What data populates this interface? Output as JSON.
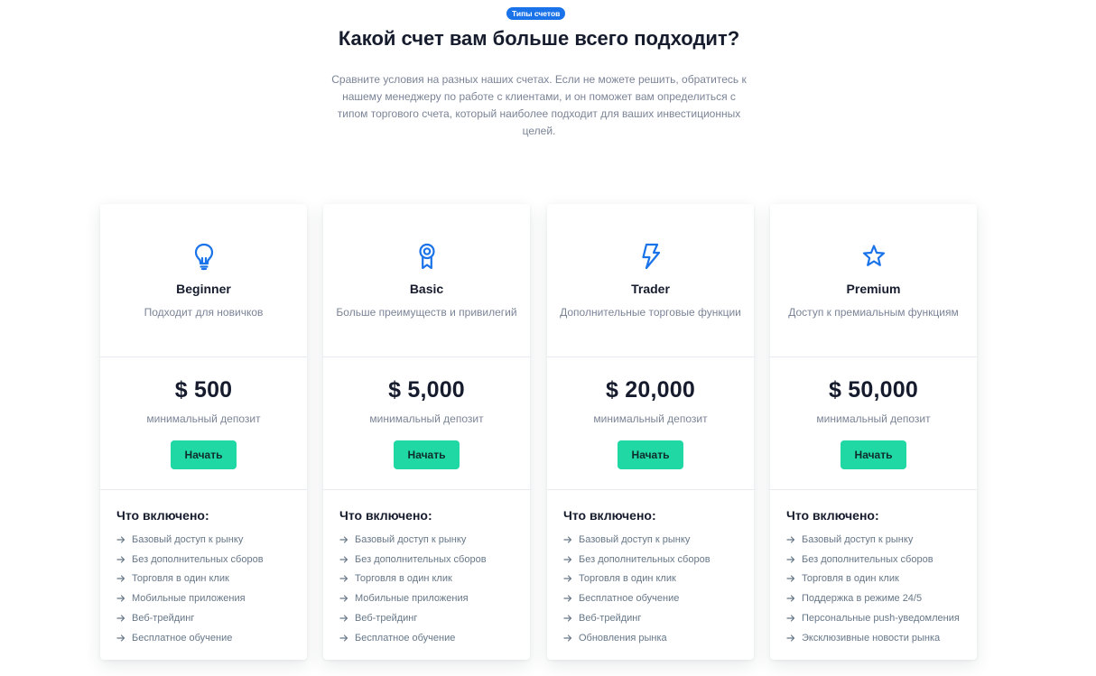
{
  "header": {
    "badge": "Типы счетов",
    "title": "Какой счет вам больше всего подходит?",
    "lead": "Сравните условия на разных наших счетах. Если не можете решить, обратитесь к нашему менеджеру по работе с клиентами, и он поможет вам определиться с типом торгового счета, который наиболее подходит для ваших инвестиционных целей."
  },
  "colors": {
    "accent": "#1a73e8",
    "button": "#1fd8a4"
  },
  "cards": [
    {
      "icon": "lightbulb-icon",
      "name": "Beginner",
      "desc": "Подходит для новичков",
      "price": "$ 500",
      "price_note": "минимальный депозит",
      "button": "Начать",
      "included_title": "Что включено:",
      "features": [
        "Базовый доступ к рынку",
        "Без дополнительных сборов",
        "Торговля в один клик",
        "Мобильные приложения",
        "Веб-трейдинг",
        "Бесплатное обучение"
      ]
    },
    {
      "icon": "award-icon",
      "name": "Basic",
      "desc": "Больше преимуществ и привилегий",
      "price": "$ 5,000",
      "price_note": "минимальный депозит",
      "button": "Начать",
      "included_title": "Что включено:",
      "features": [
        "Базовый доступ к рынку",
        "Без дополнительных сборов",
        "Торговля в один клик",
        "Мобильные приложения",
        "Веб-трейдинг",
        "Бесплатное обучение"
      ]
    },
    {
      "icon": "lightning-icon",
      "name": "Trader",
      "desc": "Дополнительные торговые функции",
      "price": "$ 20,000",
      "price_note": "минимальный депозит",
      "button": "Начать",
      "included_title": "Что включено:",
      "features": [
        "Базовый доступ к рынку",
        "Без дополнительных сборов",
        "Торговля в один клик",
        "Бесплатное обучение",
        "Веб-трейдинг",
        "Обновления рынка"
      ]
    },
    {
      "icon": "star-icon",
      "name": "Premium",
      "desc": "Доступ к премиальным функциям",
      "price": "$ 50,000",
      "price_note": "минимальный депозит",
      "button": "Начать",
      "included_title": "Что включено:",
      "features": [
        "Базовый доступ к рынку",
        "Без дополнительных сборов",
        "Торговля в один клик",
        "Поддержка в режиме 24/5",
        "Персональные push-уведомления",
        "Эксклюзивные новости рынка"
      ]
    }
  ]
}
